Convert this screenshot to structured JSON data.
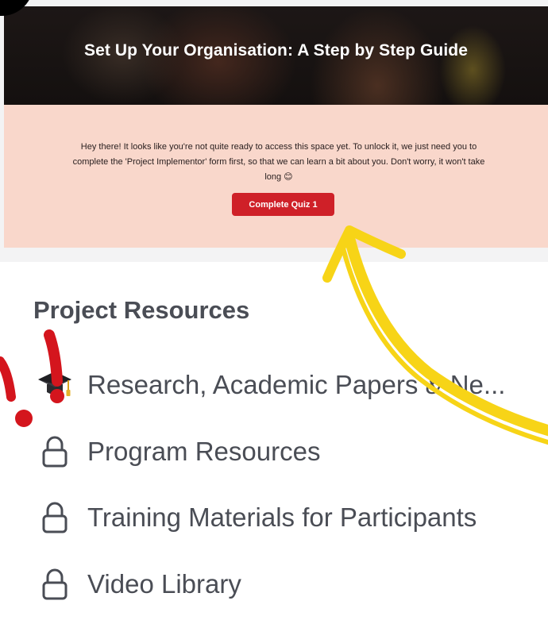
{
  "hero": {
    "title": "Set Up Your Organisation: A Step by Step Guide"
  },
  "notice": {
    "message": "Hey there! It looks like you're not quite ready to access this space yet. To unlock it, we just need you to complete the 'Project Implementor' form first, so that we can learn a bit about you. Don't worry, it won't take long 😊",
    "button_label": "Complete Quiz 1"
  },
  "resources": {
    "title": "Project Resources",
    "items": [
      {
        "label": "Research, Academic Papers & Ne...",
        "icon": "graduation-cap-icon"
      },
      {
        "label": "Program Resources",
        "icon": "lock-icon"
      },
      {
        "label": "Training Materials for Participants",
        "icon": "lock-icon"
      },
      {
        "label": "Video Library",
        "icon": "lock-icon"
      }
    ]
  },
  "colors": {
    "notice_bg": "#f9d7cb",
    "button": "#cf2028",
    "annotation_arrow": "#f7d417",
    "annotation_exclaim": "#d4151d"
  }
}
